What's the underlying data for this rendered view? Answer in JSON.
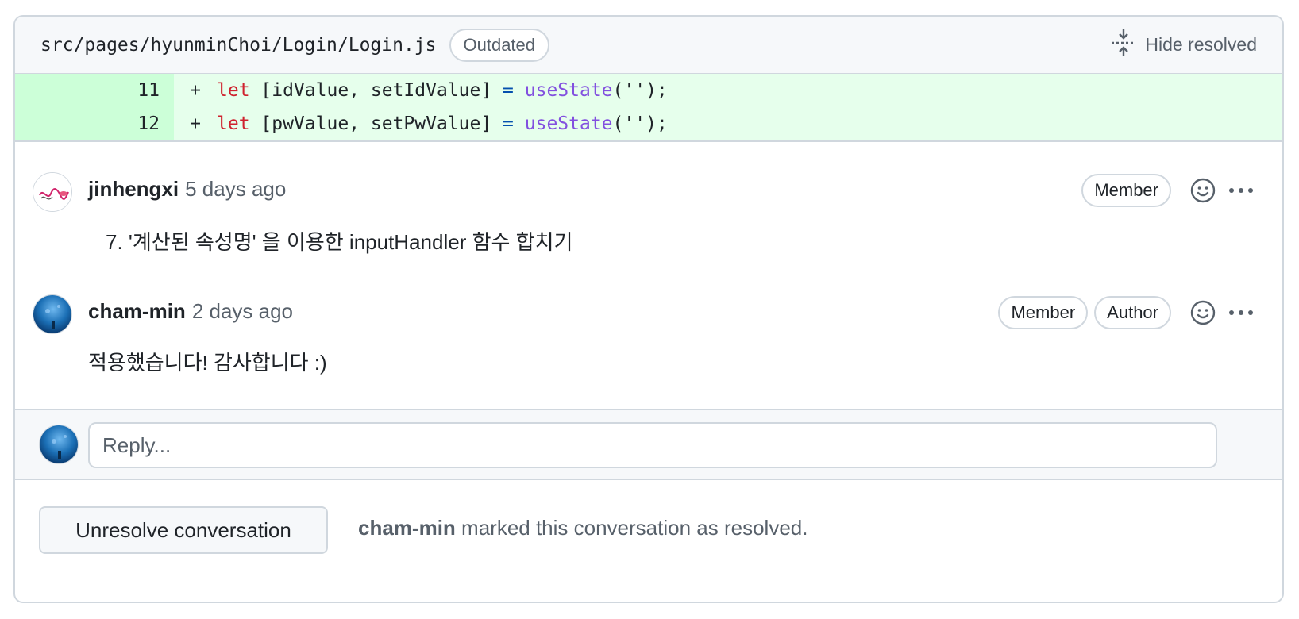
{
  "file": {
    "path": "src/pages/hyunminChoi/Login/Login.js",
    "badge": "Outdated",
    "hide_resolved_label": "Hide resolved"
  },
  "diff_lines": [
    {
      "number": "11",
      "sign": "+",
      "keyword": "let",
      "middle": " [idValue, setIdValue] ",
      "equals": "=",
      "fn": " useState",
      "tail": "('');"
    },
    {
      "number": "12",
      "sign": "+",
      "keyword": "let",
      "middle": " [pwValue, setPwValue] ",
      "equals": "=",
      "fn": " useState",
      "tail": "('');"
    }
  ],
  "comments": [
    {
      "author": "jinhengxi",
      "time": "5 days ago",
      "badges": [
        "Member"
      ],
      "body": "7. '계산된 속성명' 을 이용한 inputHandler 함수 합치기"
    },
    {
      "author": "cham-min",
      "time": "2 days ago",
      "badges": [
        "Member",
        "Author"
      ],
      "body": "적용했습니다! 감사합니다 :)"
    }
  ],
  "reply": {
    "placeholder": "Reply..."
  },
  "footer": {
    "button_label": "Unresolve conversation",
    "resolver": "cham-min",
    "resolved_text": " marked this conversation as resolved."
  },
  "colors": {
    "diff_bg": "#e6ffec",
    "diff_num_bg": "#ccffd8",
    "keyword": "#cf222e",
    "function": "#8250df",
    "border": "#d0d7de"
  }
}
